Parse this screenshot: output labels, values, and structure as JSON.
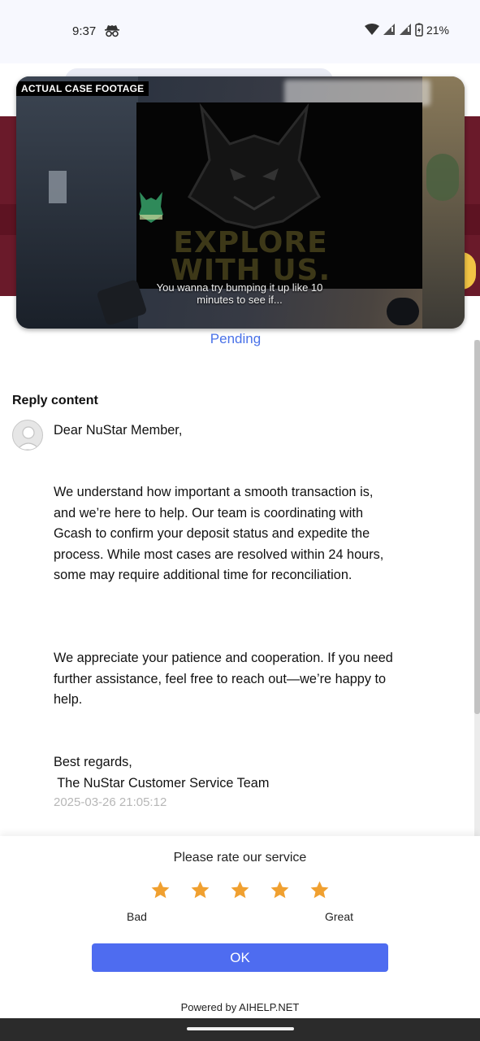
{
  "status_bar": {
    "time": "9:37",
    "battery": "21%",
    "icons": [
      "incognito-icon",
      "wifi-icon",
      "signal-icon",
      "signal-icon",
      "battery-charging-icon"
    ]
  },
  "video": {
    "tag": "ACTUAL CASE FOOTAGE",
    "screen_text": "EXPLORE\nWITH US",
    "caption": "You wanna try bumping it up like 10 minutes to see if..."
  },
  "ticket": {
    "status": "Pending"
  },
  "reply": {
    "title": "Reply content",
    "greeting": "Dear NuStar Member,",
    "paragraph1": "We understand how important a smooth transaction is, and we’re here to help. Our team is coordinating with Gcash to confirm your deposit status and expedite the process. While most cases are resolved within 24 hours, some may require additional time for reconciliation.",
    "paragraph2": "We appreciate your patience and cooperation. If you need further assistance, feel free to reach out—we’re happy to help.",
    "closing": "Best regards,",
    "signature": " The NuStar Customer Service Team",
    "timestamp": "2025-03-26 21:05:12"
  },
  "rating": {
    "title": "Please rate our service",
    "stars_filled": 5,
    "stars_total": 5,
    "star_color": "#f0a030",
    "label_low": "Bad",
    "label_high": "Great",
    "ok_label": "OK",
    "button_color": "#4e6cf0"
  },
  "footer": {
    "powered_by": "Powered by AIHELP.NET"
  },
  "colors": {
    "accent_blue": "#4a72e8",
    "header_maroon": "#6a1a2a"
  }
}
